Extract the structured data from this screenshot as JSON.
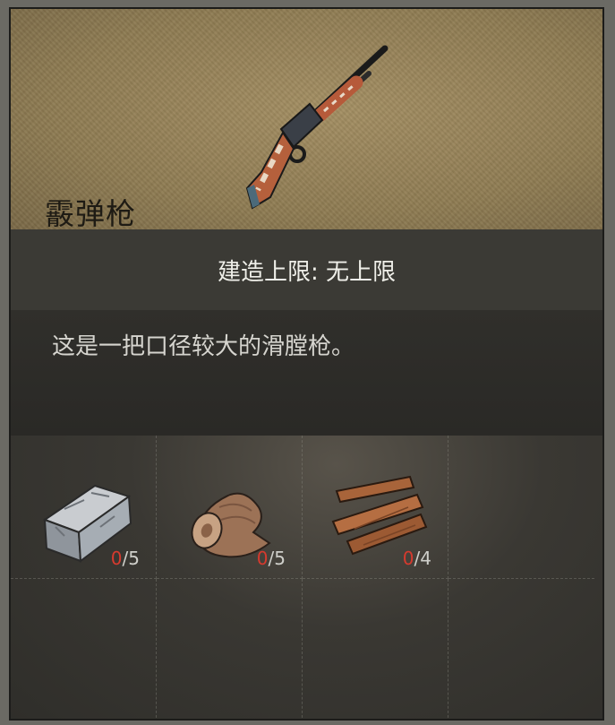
{
  "item": {
    "name": "霰弹枪",
    "icon": "shotgun-icon",
    "build_limit": "建造上限: 无上限",
    "description": "这是一把口径较大的滑膛枪。"
  },
  "materials": [
    {
      "icon": "metal-ingot-icon",
      "have": "0",
      "need": "/5"
    },
    {
      "icon": "leather-roll-icon",
      "have": "0",
      "need": "/5"
    },
    {
      "icon": "wood-planks-icon",
      "have": "0",
      "need": "/4"
    }
  ],
  "colors": {
    "count_have": "#d63a2e",
    "header_bg": "#8f7c53"
  }
}
